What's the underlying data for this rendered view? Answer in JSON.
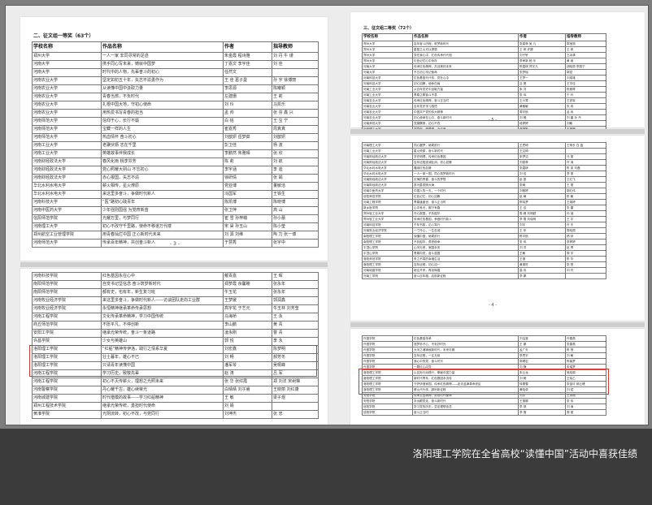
{
  "caption": "洛阳理工学院在全省高校“读懂中国”活动中喜获佳绩",
  "left_page": {
    "section_title": "二、征文组一等奖（63个）",
    "headers": [
      "学校名称",
      "作品名称",
      "作者",
      "指导教师"
    ],
    "rows": [
      [
        "郑州大学",
        "一人一家 非同寻常的足迹",
        "朱金霞  程诗雅",
        "刘  丹  牛  谨"
      ],
      [
        "河南大学",
        "携手同心写未来，铸就中国梦",
        "丁嘉文  李宇佳",
        "刘  佳"
      ],
      [
        "河南大学",
        "时代中的人物，先辈奋斗的初心",
        "任然文",
        ""
      ],
      [
        "河南农业大学",
        "坚定如初五十年，矢志不渝勇作为",
        "王  佳  葛子曼",
        "孙  宇  徐博丽"
      ],
      [
        "河南农业大学",
        "从读懂中国中汲取力量",
        "李思源",
        "陈曦颖"
      ],
      [
        "河南农业大学",
        "青春当燃，不负时代",
        "左建珊",
        "王  莉"
      ],
      [
        "河南农业大学",
        "扎根中国大地，守初心使命",
        "刘  玲",
        "马凯乐"
      ],
      [
        "河南农业大学",
        "用热爱书写青春的担当",
        "孟  帅",
        "张  芬  鑫  兴"
      ],
      [
        "河南师范大学",
        "信仰于心，长行不辍",
        "白  铭",
        "王  宝  宁"
      ],
      [
        "河南师范大学",
        "宝藏一样的人生",
        "崔嘉秀",
        "周真真"
      ],
      [
        "河南师范大学",
        "热血情怀 奋斗初心",
        "刘歆妍  岳梦茹",
        "刘歆妍"
      ],
      [
        "河南工业大学",
        "老骥伏枥 志在千里",
        "彭卫佳",
        "杨  波"
      ],
      [
        "河南工业大学",
        "英雄故事伴我成长",
        "李鹏然  朱雅晴",
        "张  欣"
      ],
      [
        "河南财经政法大学",
        "春风化雨 桃李芬芳",
        "陈  莉",
        "刘  航"
      ],
      [
        "河南财经政法大学",
        "党心照耀大别山 不忘初心",
        "李宇涵",
        "李  迪"
      ],
      [
        "河南财经政法大学",
        "赤心报国，矢志不渝",
        "徐研倩",
        "张  娟"
      ],
      [
        "华北水利水电大学",
        "薪火相传，星火燎原",
        "党亚博",
        "董敏洁"
      ],
      [
        "华北水利水电大学",
        "来这里多奋斗，争做时代新人",
        "冯国军",
        "王铁生"
      ],
      [
        "河南科技大学",
        "“医”路初心践青年",
        "陈凯博",
        "陈晓博"
      ],
      [
        "河南中医药大学",
        "少年强则国强 为党育新苗",
        "张卫萍",
        "高  山"
      ],
      [
        "信阳师范学院",
        "光耀万里，与梦同行",
        "崔  雪  孙梓萌",
        "孙小蕾"
      ],
      [
        "河南理工大学",
        "初心不改守千里路，使命不移谱万代楼",
        "宋  昊  孙玉山",
        "陈小莹"
      ],
      [
        "郑州航空工业管理学院",
        "用青春灿烂中国 正心新时代未来",
        "刘  源  刘维",
        "陶  力  张一博"
      ],
      [
        "河南师范大学",
        "传承百年精神，共创奋斗新人",
        "于慧秀",
        "张宇中"
      ]
    ],
    "page_number": "- 3 -"
  },
  "left_page2": {
    "rows": [
      [
        "河南科技学院",
        "红色基因永在心中",
        "戴百嘉",
        "王  晖"
      ],
      [
        "南阳师范学院",
        "自觉书记坚信念 奋斗筑梦新时代",
        "郑梦霞  余馨瞳",
        "张永年"
      ],
      [
        "南阳师范学院",
        "都有史，也有年，新生复习班",
        "牛玉花",
        "张永年"
      ],
      [
        "河南牧业经济学院",
        "来这里多奋斗，争做时代新人——访谈团队走向工业群",
        "王梦媛",
        "郭润鑫"
      ],
      [
        "河南牧业经济学院",
        "永恒精神继承革命传承思想",
        "高宇花  于艺元",
        "牛玉林  刘芳莹"
      ],
      [
        "河南工程学院",
        "文化传承革命精神，学习中国传统",
        "马海桥",
        "王  永"
      ],
      [
        "商丘师范学院",
        "不愿平凡，不停创新",
        "李山鹏",
        "黄  青"
      ],
      [
        "安阳工学院",
        "继承光荣传统，奋斗一条道路",
        "凌永刚",
        "曹  青"
      ],
      [
        "许昌学院",
        "少女与英雄山",
        "郭  悦",
        "李  永"
      ],
      [
        "洛阳理工学院",
        "“红船”精神传伊洛，践行之情系华夏",
        "刘宏鑫",
        "陈梦明"
      ],
      [
        "洛阳理工学院",
        "壮士暮年，雄心不已",
        "刘  畅",
        "郝芳冬"
      ],
      [
        "洛阳理工学院",
        "只请青年读懂中国",
        "潘军琴",
        "吴桐峰"
      ],
      [
        "河南工程学院",
        "学习历史，致敬先辈",
        "赵  涛",
        "吕  军"
      ],
      [
        "河南工程学院",
        "初心不灭传薪火，理想之光照未来",
        "张  华  张红霞",
        "郑  刘洋  宋树琳"
      ],
      [
        "河南警察学院",
        "丹心耀千古，雄心续荣光",
        "白晴晴  刘子睿",
        "王晓丽  刘红康"
      ],
      [
        "河南城建学院",
        "时代楷模的故事——学习红船精神",
        "王  敏",
        "梁子煜"
      ],
      [
        "郑州工程技术学院",
        "继承光荣传统，勇担时代使命",
        "刘  娟",
        ""
      ],
      [
        "黄淮学院",
        "光阴流转，初心不改，与党同行",
        "刘坤杰",
        "张  忠"
      ]
    ]
  },
  "right_page": {
    "section_title": "三、征文组二等奖（72个）",
    "headers": [
      "学校名称",
      "作品名称",
      "作者",
      "指导教师"
    ],
    "rows": [
      [
        "郑州大学",
        "百年奋斗历程，筑梦新时代",
        "张蔓菲  吴  凡",
        "郭宝丽"
      ],
      [
        "郑州大学",
        "星星之火可以燎原",
        "王  帆  许娜",
        "王  帆"
      ],
      [
        "郑州大学",
        "党在我心中，红色传承代代相",
        "刘子轩",
        "王冰清"
      ],
      [
        "郑州大学",
        "红色记忆心中永存",
        "李荣新  杨  乐",
        "黄  维"
      ],
      [
        "河南大学",
        "传承红色精神，共创美好未来",
        "陈嘉琪  郑宇凡",
        "胡晓丽  李丽宁"
      ],
      [
        "河南大学",
        "不忘初心牢记使命",
        "张梦瑶",
        "郭斌"
      ],
      [
        "河南科技大学",
        "红色基因代代传，党在心中",
        "王梦一",
        "刘成雄"
      ],
      [
        "河南科技大学",
        "初心如磐，使命在肩",
        "吕  昊",
        "王宇佳"
      ],
      [
        "河南工业大学",
        "从百年党史中汲取力量",
        "朱  刘",
        "陈雅琴"
      ],
      [
        "河南工业大学",
        "青春之歌奋斗不息",
        "张  伟",
        "于  玲"
      ],
      [
        "河南农业大学",
        "传承红色精神，奋斗正当时",
        "王小琴",
        "王铁军"
      ],
      [
        "河南农业大学",
        "百年党史学习感悟",
        "黄敏敏",
        "张  冉"
      ],
      [
        "河南农业大学",
        "中国共产党的伟大精神",
        "周宇航",
        "孟  冉"
      ],
      [
        "河南农业大学",
        "初心使命在心中，奋斗新时代",
        "刘  畅",
        "刘  晨  孙  丹"
      ],
      [
        "河南师范大学",
        "党旗飘扬，初心不改",
        "段婷婷",
        "刘敏"
      ],
      [
        "河南理工大学",
        "学党史，悟思想，办实事",
        "李梦影",
        "王丽娜"
      ]
    ],
    "page_number": "- 5 -"
  },
  "right_page2": {
    "rows": [
      [
        "河南理工大学",
        "同心圆梦，砥砺前行",
        "王思琦",
        "王明长  白  鑫"
      ],
      [
        "河南工业大学",
        "星火燎原，奋斗新时代",
        "王文琦",
        ""
      ],
      [
        "河南财经政法大学",
        "学史明理，传承红色基因",
        "朱梦洁",
        "马  丽"
      ],
      [
        "河南财经政法大学",
        "百年征程波澜壮阔，初心如磐",
        "刘艳菲",
        "许  涛"
      ],
      [
        "华北水利水电大学",
        "赓续红色血脉",
        "张嘉琪",
        "陈  英  刘磊"
      ],
      [
        "华北水利水电大学",
        "一人一家一国，同心筑梦新时代",
        "刘  佳",
        "李  丽"
      ],
      [
        "河南财经政法大学",
        "无悔的青春，奋斗的梦想",
        "赵  曼",
        "王红飞"
      ],
      [
        "河南财经政法大学",
        "愿为星辰照大海",
        "张萌",
        "王  丽"
      ],
      [
        "河南中医药大学",
        "中国人的一天，一个时代",
        "刘雅婷",
        "郭红伟"
      ],
      [
        "信阳师范学院",
        "红色记忆，初心如磐",
        "赵  萌",
        "陈  敏"
      ],
      [
        "河南工程学院",
        "青春逢盛世，奋斗正当时",
        "陈晓梦",
        "王婉婷"
      ],
      [
        "新乡医学院",
        "心中有光，脚下有路",
        "王  佳",
        "张  雷"
      ],
      [
        "郑州轻工业大学",
        "丹心报国，不负韶华",
        "周  峰  刘明越",
        "孙  涵"
      ],
      [
        "郑州轻工业大学",
        "传承红色基因，争做时代新人",
        "李  雪  刘晓明",
        "王  宇"
      ],
      [
        "河南科技学院",
        "千年书韵，正心笃行",
        "刘宇",
        "许  东"
      ],
      [
        "河南牧业经济学院",
        "一寸丹心，一生忠诚",
        "王  彤",
        "周晓丽"
      ],
      [
        "南阳理工学院",
        "读懂中国，砥砺前行",
        "陈宇航",
        "杨  林"
      ],
      [
        "南阳理工学院",
        "不负韶华，勇担使命",
        "张  伟",
        "李婷婷"
      ],
      [
        "平顶山学院",
        "山河无恙，家国永安",
        "刘  洋",
        "赵  青"
      ],
      [
        "平顶山学院",
        "青春向党，奋斗强国",
        "王敏",
        "周  宇"
      ],
      [
        "洛阳师范学院",
        "来之不易的幸福生活",
        "王丽",
        "陈  华"
      ],
      [
        "洛阳理工学院",
        "百年征程，初心如一",
        "黄振旺",
        "张  慧"
      ],
      [
        "河南城建学院",
        "继往开来，再创辉煌",
        "高  伟",
        "刘  丹"
      ],
      [
        "河南工学院",
        "奋斗百年路，启航新征程",
        "李  娜",
        ""
      ]
    ],
    "page_number": "- 4 -"
  },
  "right_page3": {
    "rows": [
      [
        "许昌学院",
        "红色基因传承",
        "刘洁莹",
        "许春燕"
      ],
      [
        "许昌学院",
        "追梦赤子心，不负好时光",
        "王  娜",
        "张春燕"
      ],
      [
        "许昌学院",
        "大河之魂铸就新时代，未来可期",
        "孟广夫",
        "陈  慧"
      ],
      [
        "许昌学院",
        "百年征程，一往无前",
        "李思宇",
        "刘  敏"
      ],
      [
        "许昌学院",
        "我心中的党，奋斗时代",
        "郭婧岩",
        "陈馨梦"
      ],
      [
        "许昌学院",
        "一颗红心向党",
        "刘  静",
        "朱瑞梦"
      ],
      [
        "洛阳理工学院",
        "以实际行动践行，奉献中国力量",
        "朱云龙",
        "吴晓娟"
      ],
      [
        "洛阳理工学院",
        "新时代青年，红色基因永流传",
        "刘  畅",
        "王晓乙"
      ],
      [
        "洛阳理工学院",
        "守护伊洛家园，传承红色精神——走访孟津革命老区",
        "徐蕾雪",
        "张苗可  郝云峰"
      ],
      [
        "洛阳理工学院",
        "薪火代代传，踔厉新征程",
        "黄晓卓",
        "刘  斌"
      ],
      [
        "安阳学院",
        "传承五四精神，勇担时代使命",
        "刘宇",
        "王永刚"
      ],
      [
        "安阳学院",
        "永远跟党走，奋斗新时代",
        "王丽娜",
        "张  伟"
      ],
      [
        "信阳学院",
        "学习党的历史，坚定理想信念",
        "李  琪",
        "刘  涛"
      ],
      [
        "信阳学院",
        "奋斗正当时",
        "李  雪",
        "周  丽"
      ]
    ]
  }
}
